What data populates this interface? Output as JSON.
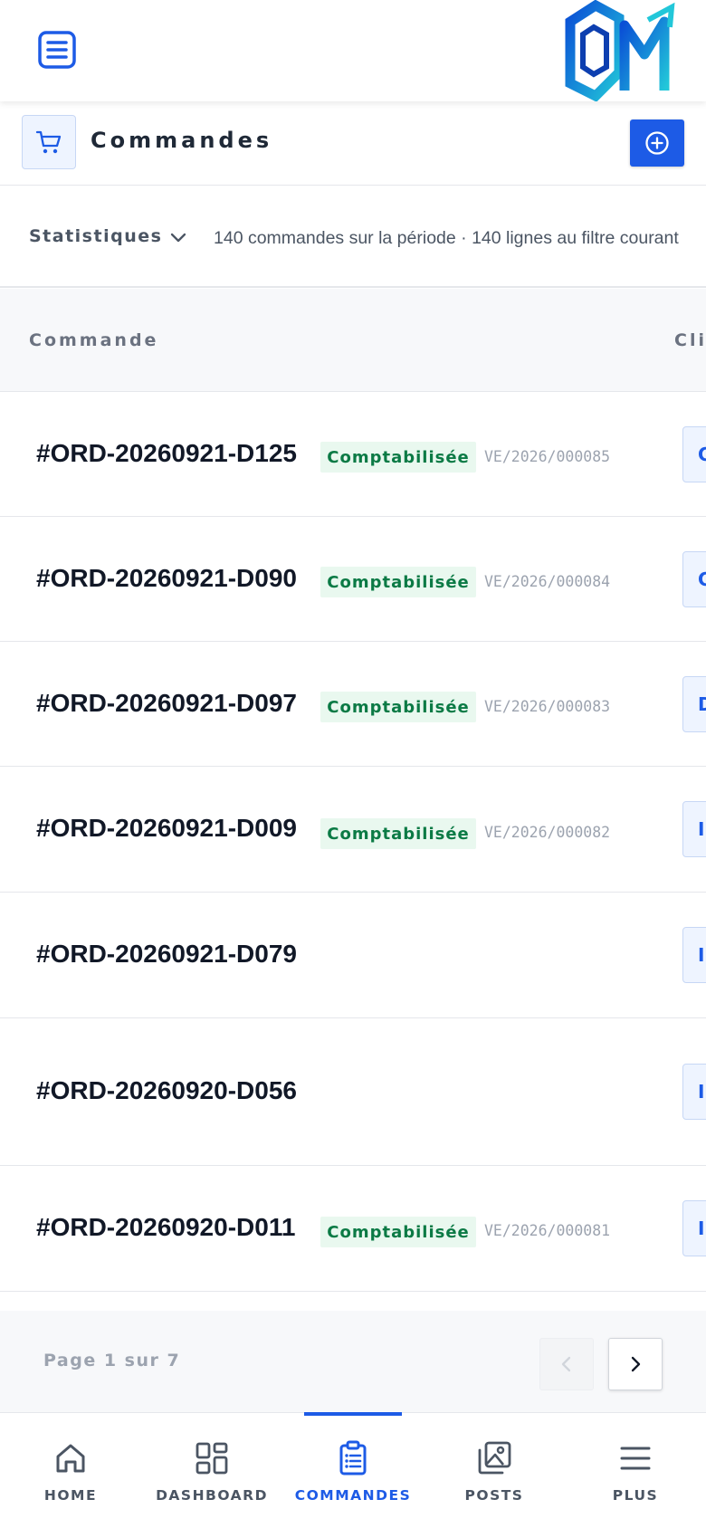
{
  "topbar": {
    "menu_icon": "menu-icon",
    "logo_icon": "om-logo"
  },
  "section": {
    "title": "Commandes",
    "icon": "cart-icon",
    "add_icon": "plus-circle-icon"
  },
  "stats": {
    "label": "Statistiques",
    "summary": "140 commandes sur la période · 140 lignes au filtre courant"
  },
  "table": {
    "columns": [
      "Commande",
      "Client"
    ],
    "rows": [
      {
        "id": "#ORD-20260921-D125",
        "status": "Comptabilisée",
        "invoice": "VE/2026/000085",
        "client": "C"
      },
      {
        "id": "#ORD-20260921-D090",
        "status": "Comptabilisée",
        "invoice": "VE/2026/000084",
        "client": "C"
      },
      {
        "id": "#ORD-20260921-D097",
        "status": "Comptabilisée",
        "invoice": "VE/2026/000083",
        "client": "D"
      },
      {
        "id": "#ORD-20260921-D009",
        "status": "Comptabilisée",
        "invoice": "VE/2026/000082",
        "client": "I"
      },
      {
        "id": "#ORD-20260921-D079",
        "status": "",
        "invoice": "",
        "client": "I"
      },
      {
        "id": "#ORD-20260920-D056",
        "status": "",
        "invoice": "",
        "client": "I"
      },
      {
        "id": "#ORD-20260920-D011",
        "status": "Comptabilisée",
        "invoice": "VE/2026/000081",
        "client": "I"
      }
    ]
  },
  "pagination": {
    "text": "Page 1 sur 7",
    "current": 1,
    "total": 7
  },
  "nav": {
    "items": [
      {
        "label": "HOME",
        "icon": "home-icon"
      },
      {
        "label": "DASHBOARD",
        "icon": "dashboard-icon"
      },
      {
        "label": "COMMANDES",
        "icon": "clipboard-icon",
        "active": true
      },
      {
        "label": "POSTS",
        "icon": "image-icon"
      },
      {
        "label": "PLUS",
        "icon": "hamburger-icon"
      }
    ]
  },
  "colors": {
    "accent": "#1d5be6",
    "success_bg": "#e9f8ef",
    "success_text": "#0b7a45"
  }
}
